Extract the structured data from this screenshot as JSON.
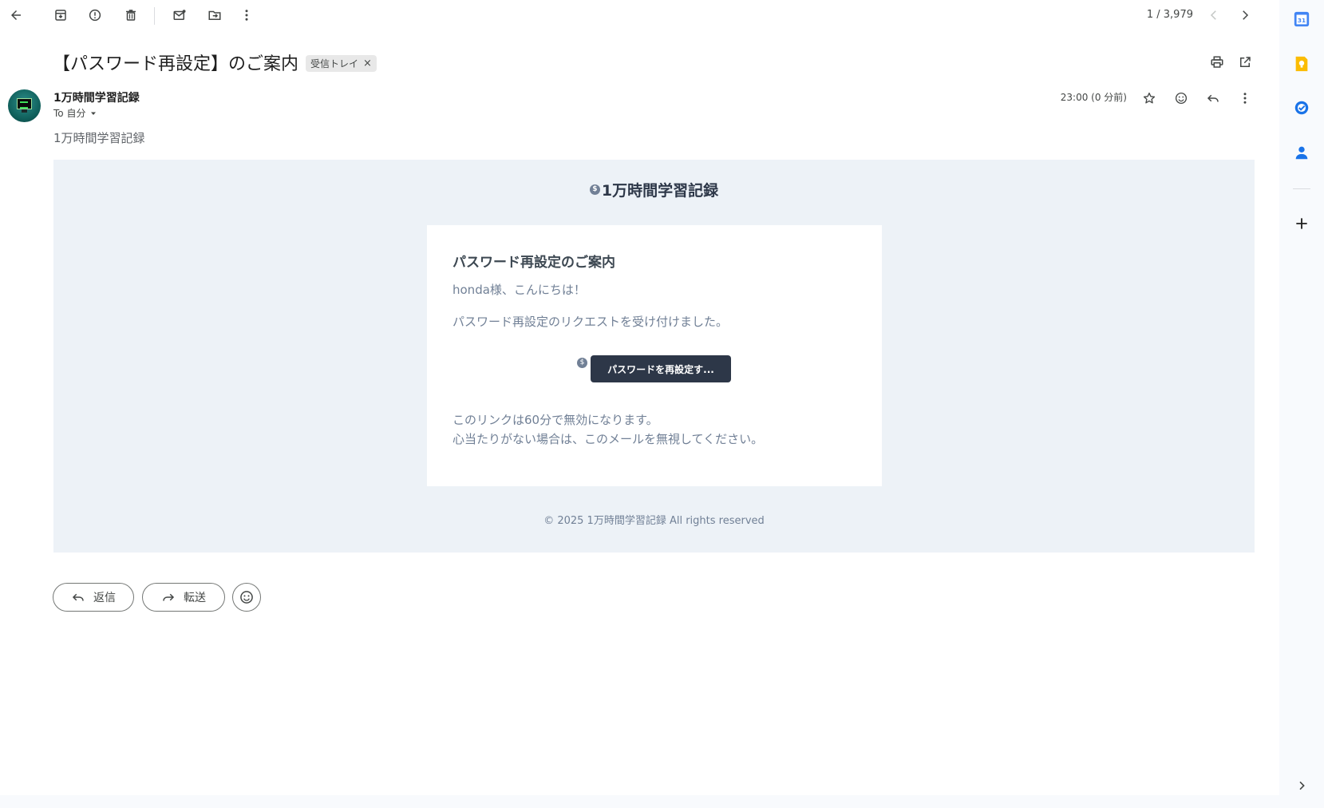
{
  "toolbar": {
    "back_icon": "arrow-left-icon",
    "archive_icon": "archive-icon",
    "spam_icon": "report-spam-icon",
    "delete_icon": "trash-icon",
    "mark_unread_icon": "mark-unread-icon",
    "move_icon": "move-to-folder-icon",
    "more_icon": "more-vert-icon",
    "pager_text": "1 / 3,979"
  },
  "email": {
    "subject": "【パスワード再設定】のご案内",
    "label": "受信トレイ",
    "label_remove": "×",
    "sender_name": "1万時間学習記録",
    "to_text": "To 自分",
    "timestamp": "23:00 (0 分前)",
    "snippet": "1万時間学習記録"
  },
  "body": {
    "brand": "1万時間学習記録",
    "badge": "$",
    "card_title": "パスワード再設定のご案内",
    "greeting": "honda様、こんにちは！",
    "request_line": "パスワード再設定のリクエストを受け付けました。",
    "reset_button": "パスワードを再設定す...",
    "note1": "このリンクは60分で無効になります。",
    "note2": "心当たりがない場合は、このメールを無視してください。",
    "footer": "©  2025  1万時間学習記録  All rights reserved"
  },
  "actions": {
    "reply": "返信",
    "forward": "転送"
  },
  "side_panel": {
    "calendar_day": "31",
    "items": [
      "calendar-icon",
      "keep-icon",
      "tasks-icon",
      "contacts-icon",
      "add-icon",
      "expand-icon"
    ]
  },
  "colors": {
    "body_bg": "#edf2f7",
    "button_bg": "#2d3748",
    "text_muted": "#718096"
  }
}
